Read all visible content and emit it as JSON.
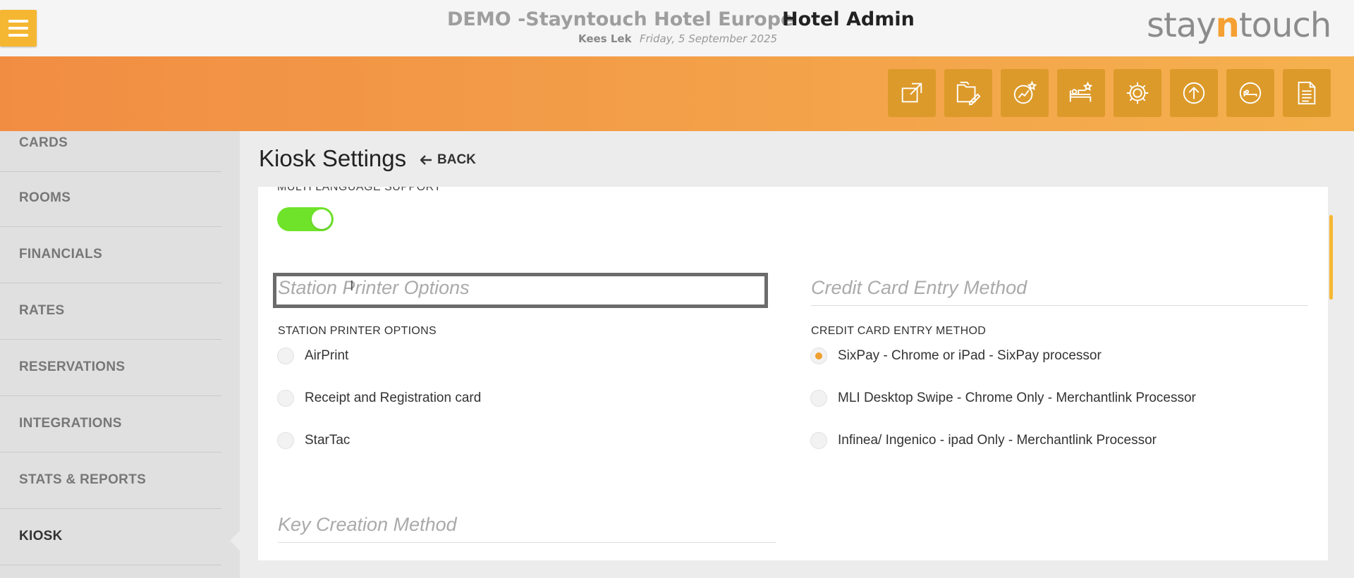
{
  "header": {
    "hotel_name": "DEMO -Stayntouch Hotel Europe",
    "section_title": "Hotel Admin",
    "user_name": "Kees Lek",
    "date": "Friday, 5 September 2025",
    "logo": {
      "part1": "stay",
      "part2": "n",
      "part3": "touch"
    }
  },
  "toolbar": {
    "icons": [
      "external-link-icon",
      "folder-edit-icon",
      "chart-star-icon",
      "bed-star-icon",
      "gear-icon",
      "upload-icon",
      "guest-bed-icon",
      "document-icon"
    ]
  },
  "sidebar": {
    "items": [
      {
        "label": "CARDS"
      },
      {
        "label": "ROOMS"
      },
      {
        "label": "FINANCIALS"
      },
      {
        "label": "RATES"
      },
      {
        "label": "RESERVATIONS"
      },
      {
        "label": "INTEGRATIONS"
      },
      {
        "label": "STATS & REPORTS"
      },
      {
        "label": "KIOSK"
      }
    ],
    "active": "KIOSK"
  },
  "page": {
    "title": "Kiosk Settings",
    "back_label": "BACK"
  },
  "settings": {
    "multi_language_label": "MULTI LANGUAGE SUPPORT",
    "multi_language_enabled": true,
    "station_printer": {
      "heading": "Station Printer Options",
      "label": "STATION PRINTER OPTIONS",
      "options": [
        "AirPrint",
        "Receipt and Registration card",
        "StarTac"
      ],
      "selected": null
    },
    "credit_card": {
      "heading": "Credit Card Entry Method",
      "label": "CREDIT CARD ENTRY METHOD",
      "options": [
        "SixPay - Chrome or iPad - SixPay processor",
        "MLI Desktop Swipe - Chrome Only - Merchantlink Processor",
        "Infinea/ Ingenico - ipad Only - Merchantlink Processor"
      ],
      "selected": "SixPay - Chrome or iPad - SixPay processor"
    },
    "key_creation": {
      "heading": "Key Creation Method"
    }
  },
  "colors": {
    "accent": "#f5b731",
    "orange_start": "#f18d43",
    "orange_end": "#f5b14f",
    "toggle_on": "#6fe32a",
    "radio_selected": "#f0a030"
  }
}
